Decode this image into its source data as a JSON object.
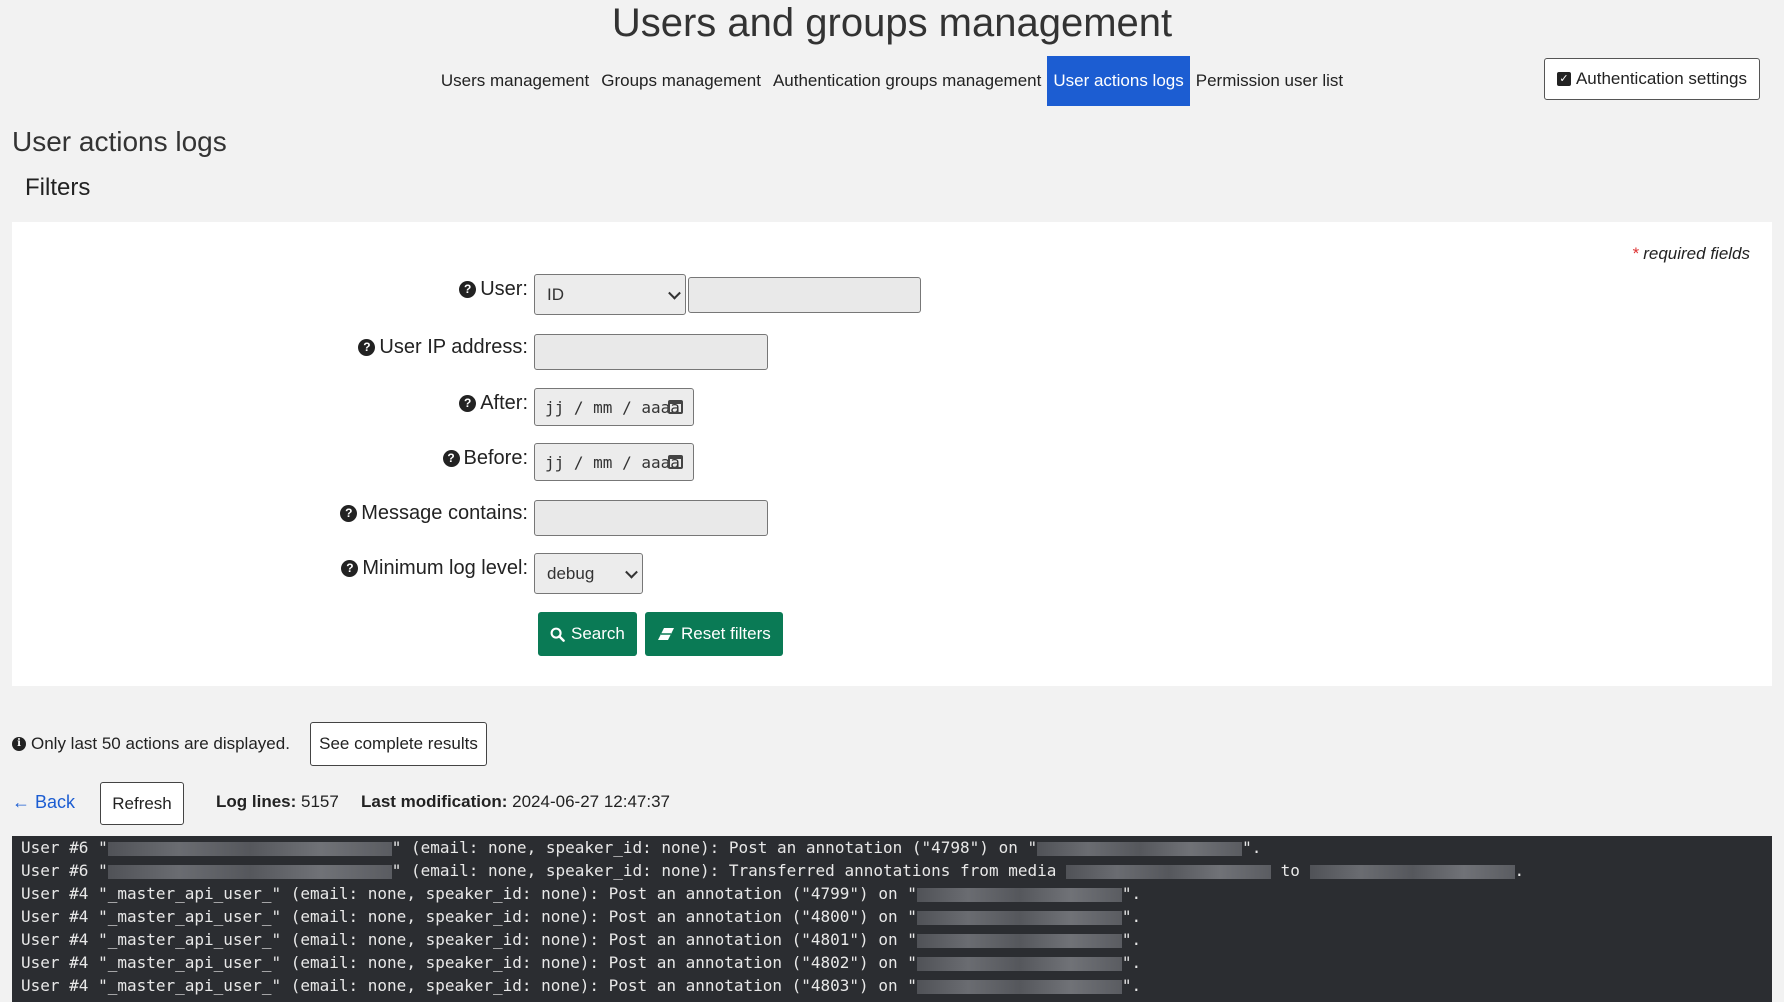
{
  "page_title": "Users and groups management",
  "tabs": [
    {
      "label": "Users management"
    },
    {
      "label": "Groups management"
    },
    {
      "label": "Authentication groups management"
    },
    {
      "label": "User actions logs"
    },
    {
      "label": "Permission user list"
    }
  ],
  "auth_settings_label": "Authentication settings",
  "section_title": "User actions logs",
  "filters_title": "Filters",
  "required_note": "required fields",
  "required_star": "*",
  "form": {
    "user_label": "User:",
    "user_type_value": "ID",
    "ip_label": "User IP address:",
    "after_label": "After:",
    "before_label": "Before:",
    "date_placeholder": "jj / mm / aaaa",
    "message_label": "Message contains:",
    "level_label": "Minimum log level:",
    "level_value": "debug",
    "search_label": "Search",
    "reset_label": "Reset filters"
  },
  "info_text": "Only last 50 actions are displayed.",
  "complete_results_label": "See complete results",
  "back_label": "← Back",
  "refresh_label": "Refresh",
  "log_lines_label": "Log lines:",
  "log_lines_value": "5157",
  "last_mod_label": "Last modification:",
  "last_mod_value": "2024-06-27 12:47:37",
  "log": {
    "line1_a": "User #6 \"",
    "line1_b": "\" (email: none, speaker_id: none): Post an annotation (\"4798\") on \"",
    "line1_c": "\".",
    "line2_a": "User #6 \"",
    "line2_b": "\" (email: none, speaker_id: none): Transferred annotations from media ",
    "line2_c": " to ",
    "line2_d": ".",
    "line3_a": "User #4 \"_master_api_user_\" (email: none, speaker_id: none): Post an annotation (\"4799\") on \"",
    "line3_b": "\".",
    "line4_a": "User #4 \"_master_api_user_\" (email: none, speaker_id: none): Post an annotation (\"4800\") on \"",
    "line4_b": "\".",
    "line5_a": "User #4 \"_master_api_user_\" (email: none, speaker_id: none): Post an annotation (\"4801\") on \"",
    "line5_b": "\".",
    "line6_a": "User #4 \"_master_api_user_\" (email: none, speaker_id: none): Post an annotation (\"4802\") on \"",
    "line6_b": "\".",
    "line7_a": "User #4 \"_master_api_user_\" (email: none, speaker_id: none): Post an annotation (\"4803\") on \"",
    "line7_b": "\"."
  }
}
